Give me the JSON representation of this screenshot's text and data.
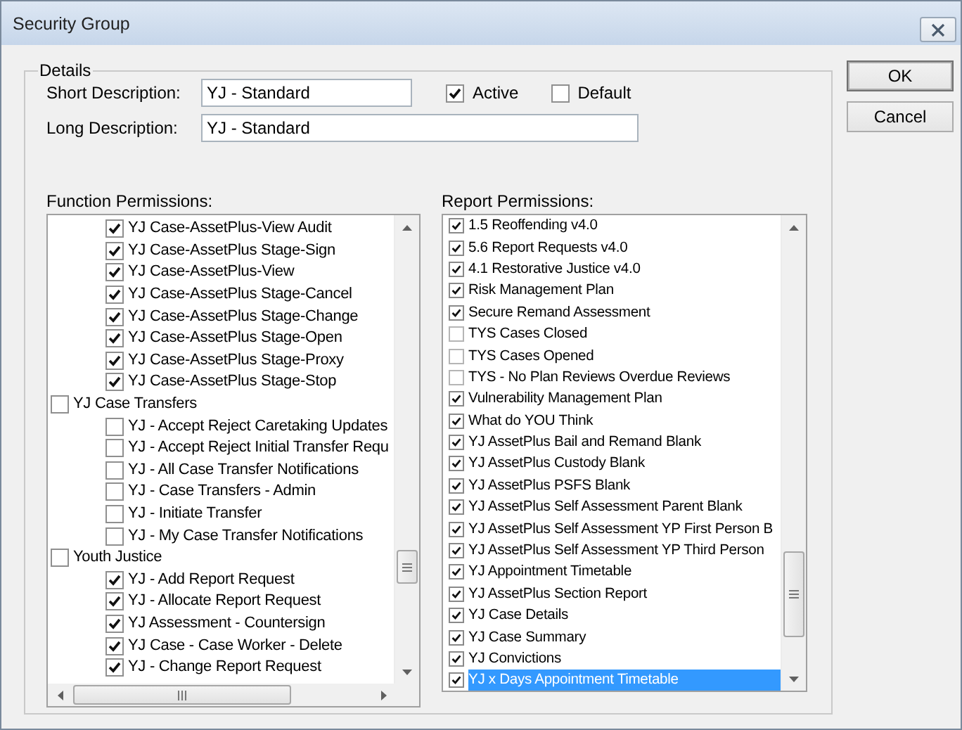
{
  "window": {
    "title": "Security Group"
  },
  "details": {
    "legend": "Details",
    "short_description": {
      "label": "Short Description:",
      "value": "YJ - Standard"
    },
    "long_description": {
      "label": "Long Description:",
      "value": "YJ - Standard"
    },
    "checkboxes": [
      {
        "label": "Active",
        "checked": true
      },
      {
        "label": "Default",
        "checked": false
      }
    ]
  },
  "function_permissions": {
    "label": "Function Permissions:",
    "items": [
      {
        "children": [
          {
            "label": "YJ Case-AssetPlus-View Audit",
            "checked": true
          },
          {
            "label": "YJ Case-AssetPlus Stage-Sign",
            "checked": true
          },
          {
            "label": "YJ Case-AssetPlus-View",
            "checked": true
          },
          {
            "label": "YJ Case-AssetPlus Stage-Cancel",
            "checked": true
          },
          {
            "label": "YJ Case-AssetPlus Stage-Change",
            "checked": true
          },
          {
            "label": "YJ Case-AssetPlus Stage-Open",
            "checked": true
          },
          {
            "label": "YJ Case-AssetPlus Stage-Proxy",
            "checked": true
          },
          {
            "label": "YJ Case-AssetPlus Stage-Stop",
            "checked": true
          }
        ]
      },
      {
        "label": "YJ Case Transfers",
        "checked": false,
        "children": [
          {
            "label": "YJ - Accept Reject Caretaking Updates",
            "checked": false
          },
          {
            "label": "YJ - Accept Reject Initial Transfer Requ",
            "checked": false
          },
          {
            "label": "YJ - All Case Transfer Notifications",
            "checked": false
          },
          {
            "label": "YJ - Case Transfers - Admin",
            "checked": false
          },
          {
            "label": "YJ - Initiate Transfer",
            "checked": false
          },
          {
            "label": "YJ - My Case Transfer Notifications",
            "checked": false
          }
        ]
      },
      {
        "label": "Youth Justice",
        "checked": false,
        "children": [
          {
            "label": "YJ - Add Report Request",
            "checked": true
          },
          {
            "label": "YJ - Allocate Report Request",
            "checked": true
          },
          {
            "label": "YJ Assessment - Countersign",
            "checked": true
          },
          {
            "label": "YJ Case - Case Worker - Delete",
            "checked": true
          },
          {
            "label": "YJ - Change Report Request",
            "checked": true
          }
        ]
      }
    ]
  },
  "report_permissions": {
    "label": "Report Permissions:",
    "items": [
      {
        "label": "1.5 Reoffending v4.0",
        "checked": true,
        "selected": false
      },
      {
        "label": "5.6 Report Requests v4.0",
        "checked": true,
        "selected": false
      },
      {
        "label": "4.1 Restorative Justice v4.0",
        "checked": true,
        "selected": false
      },
      {
        "label": "Risk Management Plan",
        "checked": true,
        "selected": false
      },
      {
        "label": "Secure Remand Assessment",
        "checked": true,
        "selected": false
      },
      {
        "label": "TYS Cases Closed",
        "checked": false,
        "selected": false
      },
      {
        "label": "TYS Cases Opened",
        "checked": false,
        "selected": false
      },
      {
        "label": "TYS - No Plan Reviews Overdue Reviews",
        "checked": false,
        "selected": false
      },
      {
        "label": "Vulnerability Management Plan",
        "checked": true,
        "selected": false
      },
      {
        "label": "What do YOU Think",
        "checked": true,
        "selected": false
      },
      {
        "label": "YJ AssetPlus Bail and Remand Blank",
        "checked": true,
        "selected": false
      },
      {
        "label": "YJ AssetPlus Custody Blank",
        "checked": true,
        "selected": false
      },
      {
        "label": "YJ AssetPlus PSFS Blank",
        "checked": true,
        "selected": false
      },
      {
        "label": "YJ AssetPlus Self Assessment Parent Blank",
        "checked": true,
        "selected": false
      },
      {
        "label": "YJ AssetPlus Self Assessment YP First Person B",
        "checked": true,
        "selected": false
      },
      {
        "label": "YJ AssetPlus Self Assessment YP Third Person",
        "checked": true,
        "selected": false
      },
      {
        "label": "YJ Appointment Timetable",
        "checked": true,
        "selected": false
      },
      {
        "label": "YJ AssetPlus Section Report",
        "checked": true,
        "selected": false
      },
      {
        "label": "YJ Case Details",
        "checked": true,
        "selected": false
      },
      {
        "label": "YJ Case Summary",
        "checked": true,
        "selected": false
      },
      {
        "label": "YJ Convictions",
        "checked": true,
        "selected": false
      },
      {
        "label": "YJ x Days Appointment Timetable",
        "checked": true,
        "selected": true
      }
    ]
  },
  "buttons": [
    {
      "label": "OK",
      "kind": "default"
    },
    {
      "label": "Cancel",
      "kind": "normal"
    }
  ]
}
